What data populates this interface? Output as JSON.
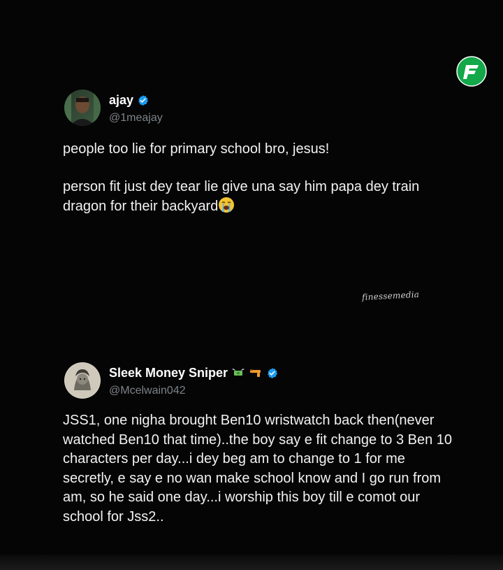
{
  "brand": {
    "icon": "finesse-media-logo-icon",
    "accent": "#13a84a"
  },
  "watermark": "finessemedia",
  "tweets": [
    {
      "display_name": "ajay",
      "handle": "@1meajay",
      "avatar_icon": "user-avatar",
      "verified": true,
      "text": "people too lie for primary school bro, jesus!\n\nperson fit just dey tear lie give una say him papa dey train dragon for their backyard",
      "trailing_emoji": "loudly-crying-face"
    },
    {
      "display_name": "Sleek Money Sniper",
      "handle": "@Mcelwain042",
      "avatar_icon": "user-avatar",
      "name_emojis": [
        "money-with-wings-icon",
        "gun-icon"
      ],
      "verified": true,
      "text": "JSS1, one nigha brought Ben10 wristwatch back then(never watched Ben10 that time)..the boy say e fit change to 3 Ben 10 characters per day...i dey beg am to change to 1 for me secretly, e say e no wan make school know and I go run from am, so he said one day...i worship this boy till e comot our school for Jss2.."
    }
  ],
  "colors": {
    "background": "#050505",
    "text": "#f2f2f2",
    "handle": "#7d8287",
    "verified": "#1d9bf0"
  }
}
